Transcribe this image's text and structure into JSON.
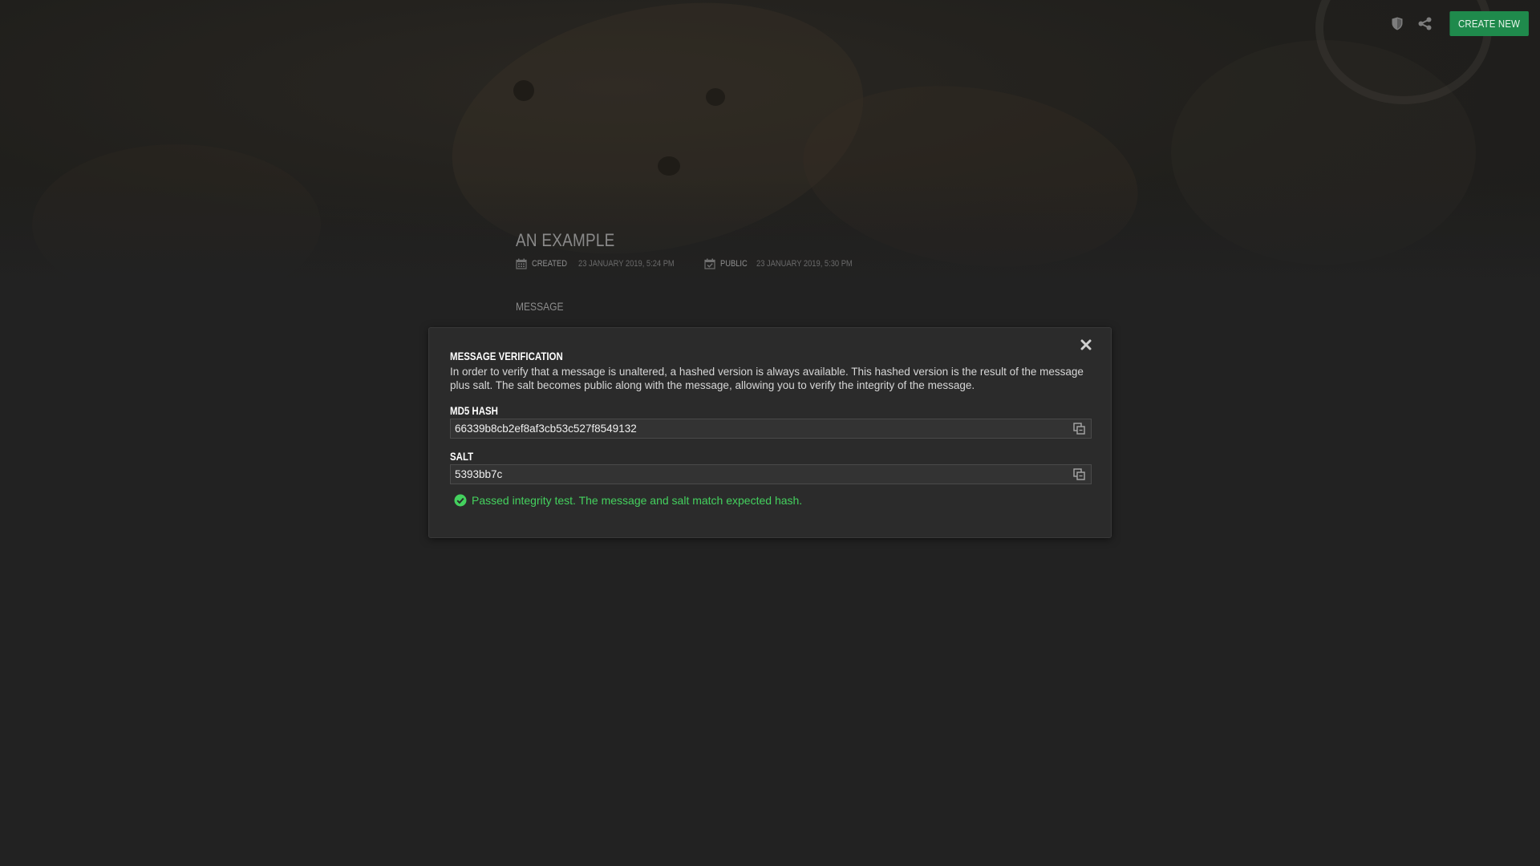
{
  "header": {
    "create_new_label": "CREATE NEW",
    "icons": [
      "shield-icon",
      "share-icon"
    ]
  },
  "page": {
    "title": "AN EXAMPLE",
    "created_label": "CREATED",
    "created_value": "23 JANUARY 2019, 5:24 PM",
    "public_label": "PUBLIC",
    "public_value": "23 JANUARY 2019, 5:30 PM",
    "message_label": "MESSAGE"
  },
  "modal": {
    "title": "MESSAGE VERIFICATION",
    "description": "In order to verify that a message is unaltered, a hashed version is always available. This hashed version is the result of the message plus salt. The salt becomes public along with the message, allowing you to verify the integrity of the message.",
    "md5_label": "MD5 HASH",
    "md5_value": "66339b8cb2ef8af3cb53c527f8549132",
    "salt_label": "SALT",
    "salt_value": "5393bb7c",
    "status_text": "Passed integrity test. The message and salt match expected hash."
  },
  "colors": {
    "background": "#222222",
    "accent_green": "#1f8a4c",
    "success_green": "#44d15e",
    "modal_bg": "#2b2b2b"
  }
}
